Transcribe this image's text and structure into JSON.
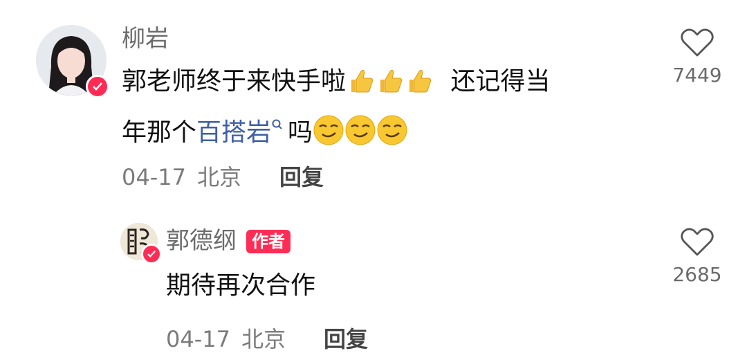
{
  "comment1": {
    "username": "柳岩",
    "text_line1": "郭老师终于来快手啦",
    "text_line1_tail": "还记得当",
    "text_line2_pre": "年那个",
    "link_text": "百搭岩",
    "text_line2_post": "吗",
    "date": "04-17",
    "location": "北京",
    "reply_label": "回复",
    "like_count": "7449"
  },
  "comment2": {
    "username": "郭德纲",
    "author_tag": "作者",
    "text": "期待再次合作",
    "like_count": "2685",
    "date_partial": "04-17",
    "location_partial": "北京",
    "reply_label": "回复"
  },
  "colors": {
    "verified": "#fe2c55",
    "link": "#3e5fa6",
    "author_tag": "#ff2c55"
  },
  "icons": [
    "heart-outline-icon",
    "verified-check-icon",
    "thumbs-up-emoji",
    "smirk-emoji",
    "search-icon"
  ]
}
